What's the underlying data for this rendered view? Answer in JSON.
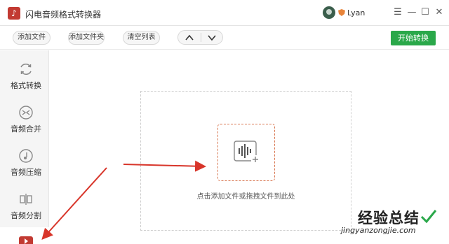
{
  "window": {
    "title": "闪电音频格式转换器",
    "logo_glyph": "♪",
    "user_name": "Lyan",
    "controls": {
      "menu": "☰",
      "minimize": "—",
      "maximize": "☐",
      "close": "✕"
    }
  },
  "toolbar": {
    "add_file": "添加文件",
    "add_folder": "添加文件夹",
    "clear_list": "清空列表",
    "start_convert": "开始转换"
  },
  "sidebar": {
    "items": [
      {
        "label": "格式转换",
        "icon": "refresh-icon"
      },
      {
        "label": "音频合并",
        "icon": "merge-icon"
      },
      {
        "label": "音频压缩",
        "icon": "compress-icon"
      },
      {
        "label": "音频分割",
        "icon": "split-icon"
      }
    ]
  },
  "dropzone": {
    "hint": "点击添加文件或拖拽文件到此处"
  },
  "watermark": {
    "title": "经验总结",
    "url": "jingyanzongjie.com"
  },
  "colors": {
    "accent_green": "#2aa84a",
    "brand_red": "#c23a32",
    "drop_orange": "#d97a55",
    "annotation_red": "#d8352a"
  }
}
